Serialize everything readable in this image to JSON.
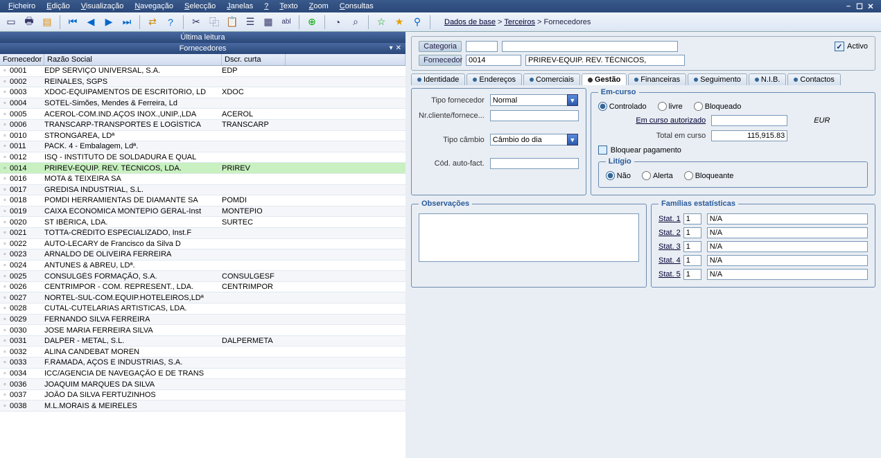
{
  "menu": [
    "Ficheiro",
    "Edição",
    "Visualização",
    "Navegação",
    "Selecção",
    "Janelas",
    "?",
    "Texto",
    "Zoom",
    "Consultas"
  ],
  "breadcrumb": {
    "a": "Dados de base",
    "b": "Terceiros",
    "c": "Fornecedores"
  },
  "left": {
    "last_read": "Última leitura",
    "title": "Fornecedores",
    "cols": {
      "fornecedor": "Fornecedor",
      "razao": "Razão Social",
      "dscr": "Dscr. curta"
    },
    "rows": [
      {
        "id": "0001",
        "name": "EDP SERVIÇO UNIVERSAL, S.A.",
        "short": "EDP"
      },
      {
        "id": "0002",
        "name": "REINALES, SGPS",
        "short": ""
      },
      {
        "id": "0003",
        "name": "XDOC-EQUIPAMENTOS DE ESCRITÓRIO, LD",
        "short": "XDOC"
      },
      {
        "id": "0004",
        "name": "SOTEL-Simões, Mendes & Ferreira, Ld",
        "short": ""
      },
      {
        "id": "0005",
        "name": "ACEROL-COM.IND.AÇOS INOX.,UNIP.,LDA",
        "short": "ACEROL"
      },
      {
        "id": "0006",
        "name": "TRANSCARP-TRANSPORTES E LOGÍSTICA",
        "short": "TRANSCARP"
      },
      {
        "id": "0010",
        "name": "STRONGÁREA, LDª",
        "short": ""
      },
      {
        "id": "0011",
        "name": "PACK. 4 - Embalagem, Ldª.",
        "short": ""
      },
      {
        "id": "0012",
        "name": "ISQ - INSTITUTO DE SOLDADURA E QUAL",
        "short": ""
      },
      {
        "id": "0014",
        "name": "PRIREV-EQUIP. REV. TÉCNICOS, LDA.",
        "short": "PRIREV",
        "sel": true
      },
      {
        "id": "0016",
        "name": "MOTA & TEIXEIRA SA",
        "short": ""
      },
      {
        "id": "0017",
        "name": "GREDISA INDUSTRIAL, S.L.",
        "short": ""
      },
      {
        "id": "0018",
        "name": "POMDI HERRAMIENTAS DE DIAMANTE SA",
        "short": "POMDI"
      },
      {
        "id": "0019",
        "name": "CAIXA ECONOMICA MONTEPIO GERAL-Inst",
        "short": "MONTEPIO"
      },
      {
        "id": "0020",
        "name": "ST IBÉRICA, LDA.",
        "short": "SURTEC"
      },
      {
        "id": "0021",
        "name": "TOTTA-CRÉDITO ESPECIALIZADO, Inst.F",
        "short": ""
      },
      {
        "id": "0022",
        "name": "AUTO-LECARY de Francisco da Silva D",
        "short": ""
      },
      {
        "id": "0023",
        "name": "ARNALDO DE OLIVEIRA FERREIRA",
        "short": ""
      },
      {
        "id": "0024",
        "name": "ANTUNES & ABREU, LDª.",
        "short": ""
      },
      {
        "id": "0025",
        "name": "CONSULGÉS FORMAÇÃO, S.A.",
        "short": "CONSULGESF"
      },
      {
        "id": "0026",
        "name": "CENTRIMPOR - COM. REPRESENT., LDA.",
        "short": "CENTRIMPOR"
      },
      {
        "id": "0027",
        "name": "NORTEL-SUL-COM.EQUIP.HOTELEIROS,LDª",
        "short": ""
      },
      {
        "id": "0028",
        "name": "CUTAL-CUTELARIAS ARTISTICAS, LDA.",
        "short": ""
      },
      {
        "id": "0029",
        "name": "FERNANDO SILVA FERREIRA",
        "short": ""
      },
      {
        "id": "0030",
        "name": "JOSE MARIA FERREIRA SILVA",
        "short": ""
      },
      {
        "id": "0031",
        "name": "DALPER - METAL, S.L.",
        "short": "DALPERMETA"
      },
      {
        "id": "0032",
        "name": "ALINA CANDEBAT MOREN",
        "short": ""
      },
      {
        "id": "0033",
        "name": "F.RAMADA, AÇOS E INDUSTRIAS, S.A.",
        "short": ""
      },
      {
        "id": "0034",
        "name": "ICC/AGENCIA DE NAVEGAÇÃO E DE TRANS",
        "short": ""
      },
      {
        "id": "0036",
        "name": "JOAQUIM MARQUES DA SILVA",
        "short": ""
      },
      {
        "id": "0037",
        "name": "JOÃO DA SILVA FERTUZINHOS",
        "short": ""
      },
      {
        "id": "0038",
        "name": "M.L.MORAIS & MEIRELES",
        "short": ""
      }
    ]
  },
  "form": {
    "categoria_lbl": "Categoria",
    "categoria_val": "",
    "fornecedor_lbl": "Fornecedor",
    "fornecedor_val": "0014",
    "fornecedor_name": "PRIREV-EQUIP. REV. TÉCNICOS,",
    "activo_lbl": "Activo",
    "tabs": [
      "Identidade",
      "Endereços",
      "Comerciais",
      "Gestão",
      "Financeiras",
      "Seguimento",
      "N.I.B.",
      "Contactos"
    ],
    "active_tab": 3,
    "gestao": {
      "tipo_forn_lbl": "Tipo fornecedor",
      "tipo_forn_val": "Normal",
      "nr_cli_lbl": "Nr.cliente/fornece...",
      "nr_cli_val": "",
      "tipo_camb_lbl": "Tipo câmbio",
      "tipo_camb_val": "Câmbio do dia",
      "cod_auto_lbl": "Cód. auto-fact.",
      "cod_auto_val": ""
    },
    "emcurso": {
      "legend": "Em-curso",
      "opts": [
        "Controlado",
        "livre",
        "Bloqueado"
      ],
      "aut_lbl": "Em curso autorizado",
      "aut_val": "",
      "aut_cur": "EUR",
      "tot_lbl": "Total em curso",
      "tot_val": "115,915.83",
      "bloq_lbl": "Bloquear pagamento",
      "lit_legend": "Litígio",
      "lit_opts": [
        "Não",
        "Alerta",
        "Bloqueante"
      ]
    },
    "obs_legend": "Observações",
    "fam_legend": "Famílias estatísticas",
    "stats": [
      {
        "lbl": "Stat. 1",
        "val": "1",
        "desc": "N/A"
      },
      {
        "lbl": "Stat. 2",
        "val": "1",
        "desc": "N/A"
      },
      {
        "lbl": "Stat. 3",
        "val": "1",
        "desc": "N/A"
      },
      {
        "lbl": "Stat. 4",
        "val": "1",
        "desc": "N/A"
      },
      {
        "lbl": "Stat. 5",
        "val": "1",
        "desc": "N/A"
      }
    ]
  }
}
